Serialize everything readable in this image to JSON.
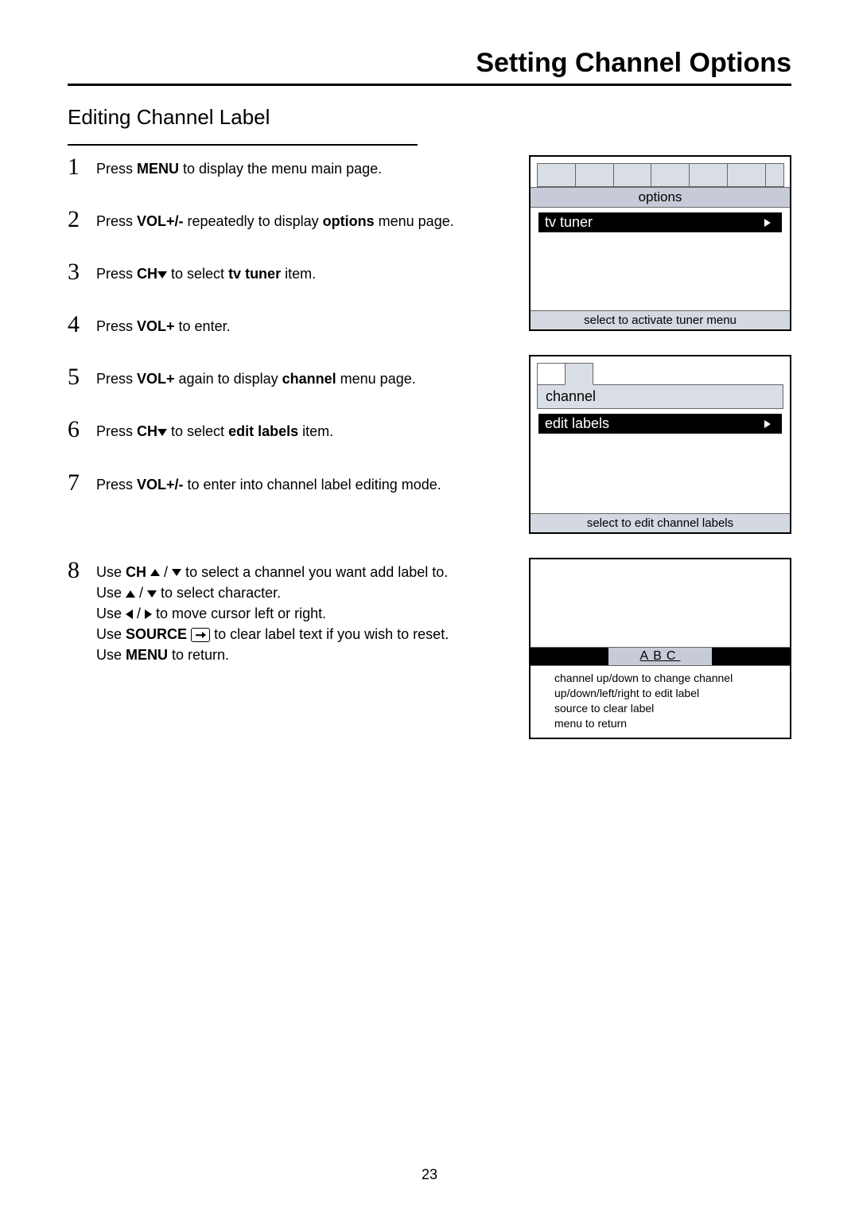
{
  "page_number": "23",
  "title": "Setting Channel Options",
  "subtitle": "Editing Channel Label",
  "steps": {
    "s1": {
      "pre": "Press ",
      "b1": "MENU",
      "post": " to display the menu main page."
    },
    "s2": {
      "pre": "Press ",
      "b1": "VOL+/-",
      "mid": " repeatedly to display ",
      "b2": "options",
      "post": " menu page."
    },
    "s3": {
      "pre": "Press ",
      "b1": "CH",
      "mid": " to select ",
      "b2": "tv tuner",
      "post": " item."
    },
    "s4": {
      "pre": "Press ",
      "b1": "VOL+",
      "post": " to enter."
    },
    "s5": {
      "pre": "Press ",
      "b1": "VOL+",
      "mid": " again to display ",
      "b2": "channel",
      "post": " menu page."
    },
    "s6": {
      "pre": "Press ",
      "b1": "CH",
      "mid": " to select ",
      "b2": "edit labels",
      "post": " item."
    },
    "s7": {
      "pre": "Press ",
      "b1": "VOL+/-",
      "post": " to enter into channel label editing mode."
    },
    "s8": {
      "l1_pre": "Use ",
      "l1_b": "CH",
      "l1_post": "  to select a channel you want add label to.",
      "l2_pre": "Use ",
      "l2_post": " to select character.",
      "l3_pre": "Use ",
      "l3_post": " to move cursor left or right.",
      "l4_pre": "Use ",
      "l4_b": "SOURCE",
      "l4_post": "  to clear label text if you wish to reset.",
      "l5_pre": "Use ",
      "l5_b": "MENU",
      "l5_post": " to return."
    }
  },
  "osd1": {
    "tab_label": "options",
    "row": "tv tuner",
    "footer": "select to activate tuner menu"
  },
  "osd2": {
    "tab_label": "channel",
    "row": "edit labels",
    "footer": "select to edit channel labels"
  },
  "osd3": {
    "value": "ABC",
    "help1": "channel up/down to change channel",
    "help2": "up/down/left/right to edit label",
    "help3": "source to clear label",
    "help4": "menu to return"
  }
}
